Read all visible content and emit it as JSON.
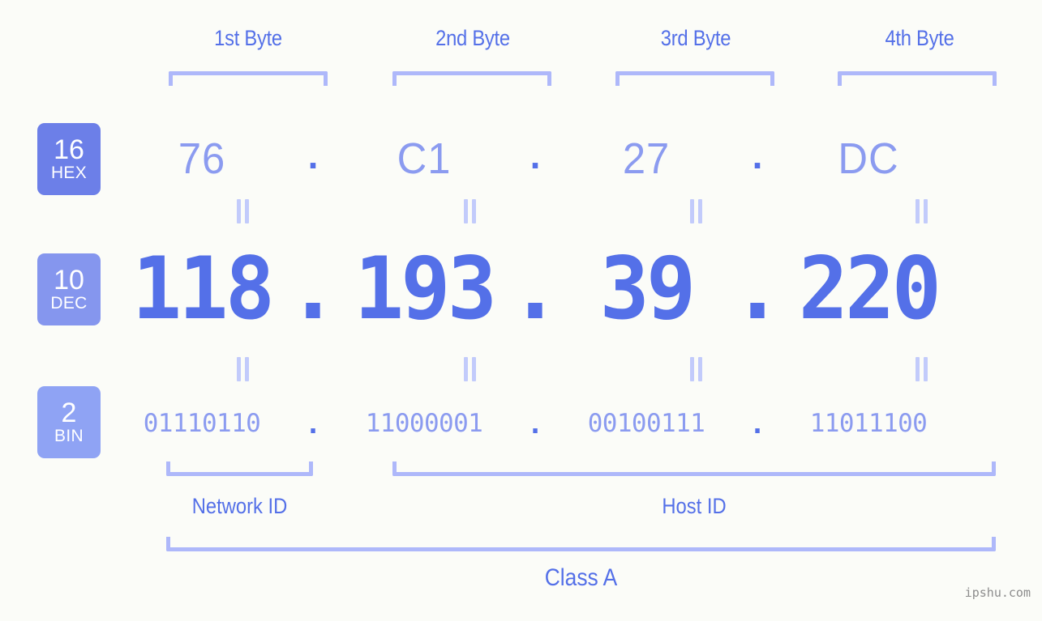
{
  "background_color": "#fbfcf8",
  "accent_color": "#5470e8",
  "accent_light_color": "#8b9bf0",
  "bracket_color": "#aeb8fa",
  "byte_headers": [
    {
      "label": "1st Byte"
    },
    {
      "label": "2nd Byte"
    },
    {
      "label": "3rd Byte"
    },
    {
      "label": "4th Byte"
    }
  ],
  "radix_badges": [
    {
      "number": "16",
      "system": "HEX",
      "color": "#6c7fe8"
    },
    {
      "number": "10",
      "system": "DEC",
      "color": "#8596ee"
    },
    {
      "number": "2",
      "system": "BIN",
      "color": "#8fa3f4"
    }
  ],
  "rows": {
    "hex": {
      "radix": "16",
      "system": "HEX",
      "values": [
        "76",
        "C1",
        "27",
        "DC"
      ],
      "separator": "."
    },
    "dec": {
      "radix": "10",
      "system": "DEC",
      "values": [
        "118",
        "193",
        "39",
        "220"
      ],
      "separator": "."
    },
    "bin": {
      "radix": "2",
      "system": "BIN",
      "values": [
        "01110110",
        "11000001",
        "00100111",
        "11011100"
      ],
      "separator": "."
    }
  },
  "equality_symbol": "=",
  "segments": {
    "network_id": "Network ID",
    "host_id": "Host ID",
    "class": "Class A"
  },
  "watermark": "ipshu.com"
}
